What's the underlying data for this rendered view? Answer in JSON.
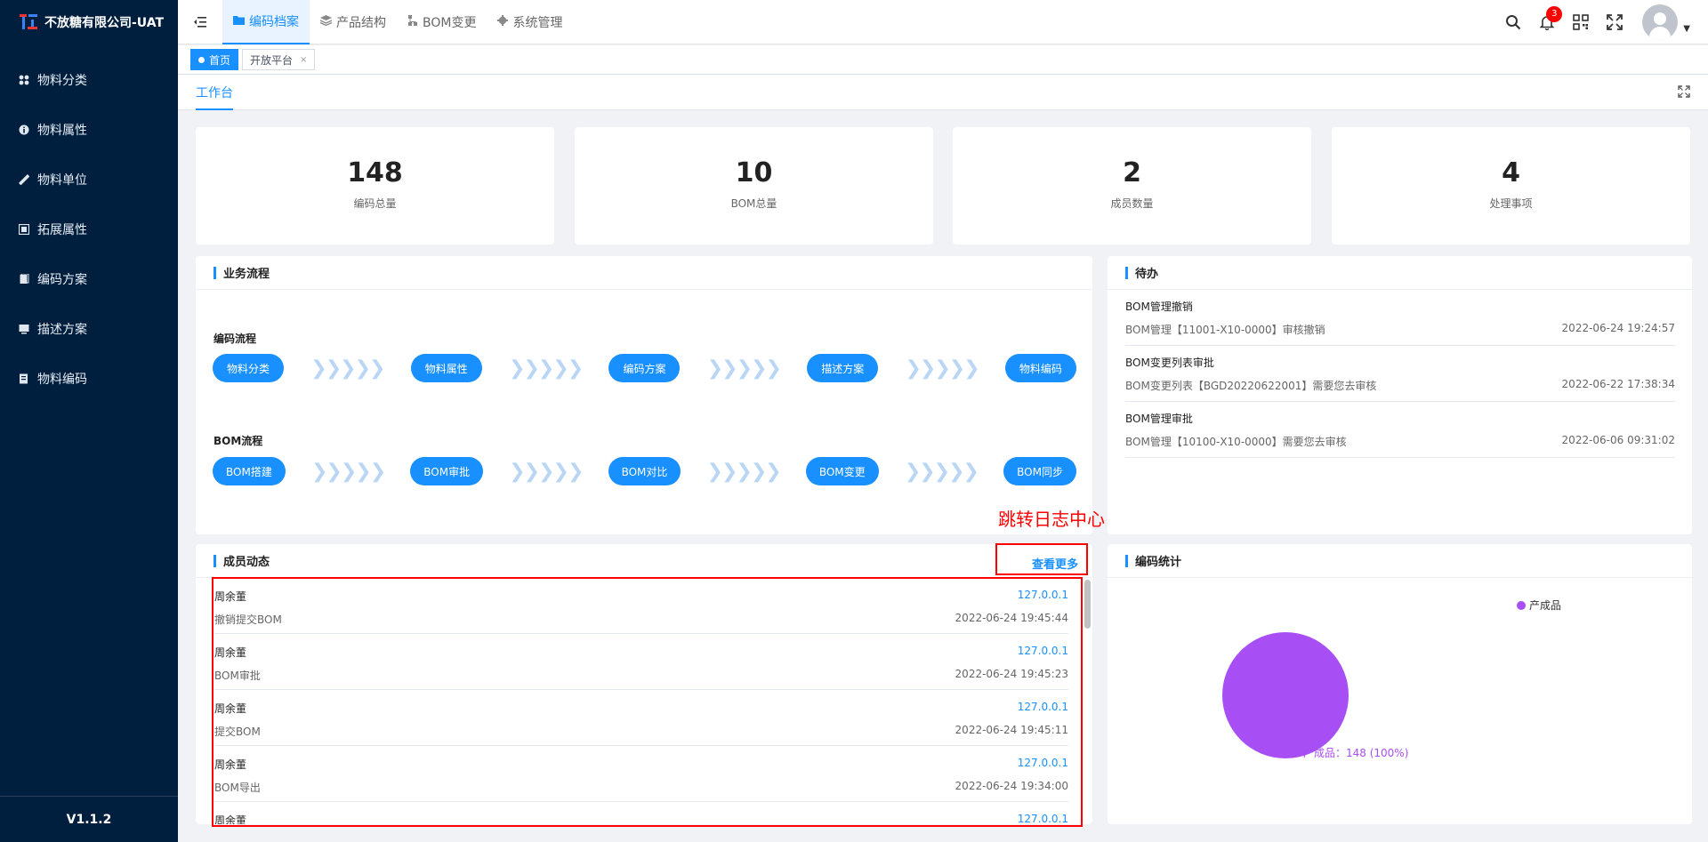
{
  "app": {
    "logo_text": "不放糖有限公司-UAT",
    "version": "V1.1.2"
  },
  "sidebar": {
    "items": [
      {
        "label": "物料分类",
        "icon": "grid-icon"
      },
      {
        "label": "物料属性",
        "icon": "info-icon"
      },
      {
        "label": "物料单位",
        "icon": "ruler-icon"
      },
      {
        "label": "拓展属性",
        "icon": "extend-icon"
      },
      {
        "label": "编码方案",
        "icon": "doc-icon"
      },
      {
        "label": "描述方案",
        "icon": "monitor-icon"
      },
      {
        "label": "物料编码",
        "icon": "code-icon"
      }
    ]
  },
  "header": {
    "tabs": [
      {
        "label": "编码档案",
        "active": true
      },
      {
        "label": "产品结构",
        "active": false
      },
      {
        "label": "BOM变更",
        "active": false
      },
      {
        "label": "系统管理",
        "active": false
      }
    ],
    "notification_count": "3"
  },
  "tagsbar": {
    "tags": [
      {
        "label": "首页",
        "active": true
      },
      {
        "label": "开放平台",
        "active": false,
        "close": "×"
      }
    ]
  },
  "subtab": {
    "label": "工作台"
  },
  "stats": [
    {
      "value": "148",
      "label": "编码总量"
    },
    {
      "value": "10",
      "label": "BOM总量"
    },
    {
      "value": "2",
      "label": "成员数量"
    },
    {
      "value": "4",
      "label": "处理事项"
    }
  ],
  "business_flow": {
    "title": "业务流程",
    "code_flow": {
      "label": "编码流程",
      "steps": [
        "物料分类",
        "物料属性",
        "编码方案",
        "描述方案",
        "物料编码"
      ]
    },
    "bom_flow": {
      "label": "BOM流程",
      "steps": [
        "BOM搭建",
        "BOM审批",
        "BOM对比",
        "BOM变更",
        "BOM同步"
      ]
    },
    "chevrons": "❯❯❯❯❯"
  },
  "todo": {
    "title": "待办",
    "items": [
      {
        "title": "BOM管理撤销",
        "desc": "BOM管理【11001-X10-0000】审核撤销",
        "time": "2022-06-24 19:24:57"
      },
      {
        "title": "BOM变更列表审批",
        "desc": "BOM变更列表【BGD20220622001】需要您去审核",
        "time": "2022-06-22 17:38:34"
      },
      {
        "title": "BOM管理审批",
        "desc": "BOM管理【10100-X10-0000】需要您去审核",
        "time": "2022-06-06 09:31:02"
      }
    ]
  },
  "members": {
    "title": "成员动态",
    "more_label": "查看更多",
    "annotation": "跳转日志中心",
    "items": [
      {
        "name": "周余董",
        "ip": "127.0.0.1",
        "action": "撤销提交BOM",
        "time": "2022-06-24 19:45:44"
      },
      {
        "name": "周余董",
        "ip": "127.0.0.1",
        "action": "BOM审批",
        "time": "2022-06-24 19:45:23"
      },
      {
        "name": "周余董",
        "ip": "127.0.0.1",
        "action": "提交BOM",
        "time": "2022-06-24 19:45:11"
      },
      {
        "name": "周余董",
        "ip": "127.0.0.1",
        "action": "BOM导出",
        "time": "2022-06-24 19:34:00"
      },
      {
        "name": "周余董",
        "ip": "127.0.0.1",
        "action": "",
        "time": ""
      }
    ]
  },
  "code_stats": {
    "title": "编码统计",
    "legend_label": "产成品",
    "slice_label": "产成品：148 (100%)",
    "color": "#a84ef5"
  },
  "chart_data": {
    "type": "pie",
    "categories": [
      "产成品"
    ],
    "values": [
      148
    ],
    "title": "编码统计"
  }
}
